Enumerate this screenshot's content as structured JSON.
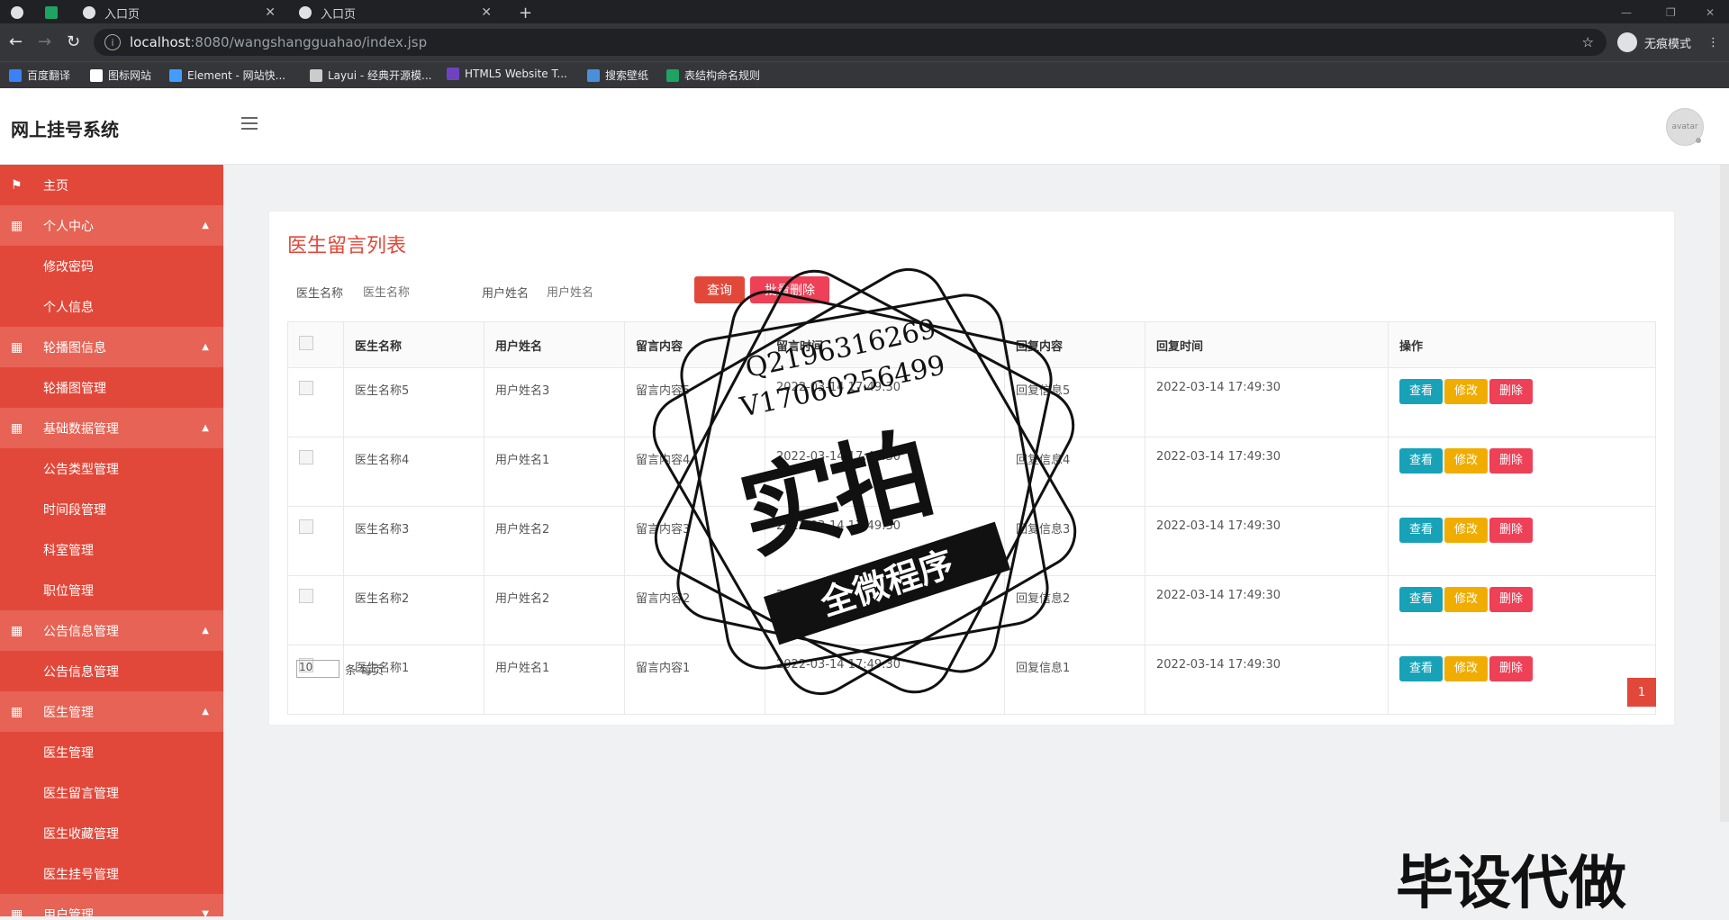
{
  "browser": {
    "tabs": [
      {
        "label": ""
      },
      {
        "label": "入口页"
      },
      {
        "label": "入口页"
      }
    ],
    "url_host": "localhost",
    "url_path": ":8080/wangshangguahao/index.jsp",
    "incognito_label": "无痕模式",
    "bookmarks": [
      {
        "label": "百度翻译",
        "color": "#3b82f6"
      },
      {
        "label": "图标网站",
        "color": "#ffffff"
      },
      {
        "label": "Element - 网站快...",
        "color": "#409eff"
      },
      {
        "label": "Layui - 经典开源模...",
        "color": "#cccccc"
      },
      {
        "label": "HTML5 Website T...",
        "color": "#6f42c1"
      },
      {
        "label": "搜索壁纸",
        "color": "#4a90d9"
      },
      {
        "label": "表结构命名规则",
        "color": "#1ea362"
      }
    ]
  },
  "app": {
    "title": "网上挂号系统",
    "avatar_text": "avatar"
  },
  "sidebar": {
    "items": [
      {
        "label": "主页",
        "type": "top",
        "icon": "flag-icon"
      },
      {
        "label": "个人中心",
        "type": "group",
        "icon": "grid-icon"
      },
      {
        "label": "修改密码",
        "type": "sub"
      },
      {
        "label": "个人信息",
        "type": "sub"
      },
      {
        "label": "轮播图信息",
        "type": "group",
        "icon": "grid-icon"
      },
      {
        "label": "轮播图管理",
        "type": "sub"
      },
      {
        "label": "基础数据管理",
        "type": "group",
        "icon": "grid-icon"
      },
      {
        "label": "公告类型管理",
        "type": "sub"
      },
      {
        "label": "时间段管理",
        "type": "sub"
      },
      {
        "label": "科室管理",
        "type": "sub"
      },
      {
        "label": "职位管理",
        "type": "sub"
      },
      {
        "label": "公告信息管理",
        "type": "group",
        "icon": "grid-icon"
      },
      {
        "label": "公告信息管理",
        "type": "sub"
      },
      {
        "label": "医生管理",
        "type": "group",
        "icon": "grid-icon"
      },
      {
        "label": "医生管理",
        "type": "sub"
      },
      {
        "label": "医生留言管理",
        "type": "sub"
      },
      {
        "label": "医生收藏管理",
        "type": "sub"
      },
      {
        "label": "医生挂号管理",
        "type": "sub"
      },
      {
        "label": "用户管理",
        "type": "group",
        "icon": "grid-icon"
      }
    ]
  },
  "main": {
    "page_title": "医生留言列表",
    "search": {
      "doctor_label": "医生名称",
      "doctor_placeholder": "医生名称",
      "user_label": "用户姓名",
      "user_placeholder": "用户姓名",
      "query_button": "查询",
      "batch_delete_button": "批量删除"
    },
    "table": {
      "headers": [
        "医生名称",
        "用户姓名",
        "留言内容",
        "留言时间",
        "回复内容",
        "回复时间",
        "操作"
      ],
      "rows": [
        {
          "doctor": "医生名称5",
          "user": "用户姓名3",
          "content": "留言内容5",
          "time": "2022-03-14 17:49:30",
          "reply": "回复信息5",
          "reply_time": "2022-03-14 17:49:30"
        },
        {
          "doctor": "医生名称4",
          "user": "用户姓名1",
          "content": "留言内容4",
          "time": "2022-03-14 17:49:30",
          "reply": "回复信息4",
          "reply_time": "2022-03-14 17:49:30"
        },
        {
          "doctor": "医生名称3",
          "user": "用户姓名2",
          "content": "留言内容3",
          "time": "2022-03-14 17:49:30",
          "reply": "回复信息3",
          "reply_time": "2022-03-14 17:49:30"
        },
        {
          "doctor": "医生名称2",
          "user": "用户姓名2",
          "content": "留言内容2",
          "time": "2022-03-14 17:49:30",
          "reply": "回复信息2",
          "reply_time": "2022-03-14 17:49:30"
        },
        {
          "doctor": "医生名称1",
          "user": "用户姓名1",
          "content": "留言内容1",
          "time": "2022-03-14 17:49:30",
          "reply": "回复信息1",
          "reply_time": "2022-03-14 17:49:30"
        }
      ],
      "actions": {
        "view": "查看",
        "edit": "修改",
        "delete": "删除"
      }
    },
    "pagination": {
      "page_size": "10",
      "per_page_label": "条 每页",
      "current_page": "1"
    }
  },
  "watermark": {
    "qq": "Q2196316269",
    "vx": "V17060256499",
    "big": "实拍",
    "ribbon": "全微程序",
    "bottom": "毕设代做"
  },
  "colors": {
    "brand": "#e2483a",
    "view": "#17a2b8",
    "edit": "#f0ad00",
    "delete": "#ee4057"
  }
}
